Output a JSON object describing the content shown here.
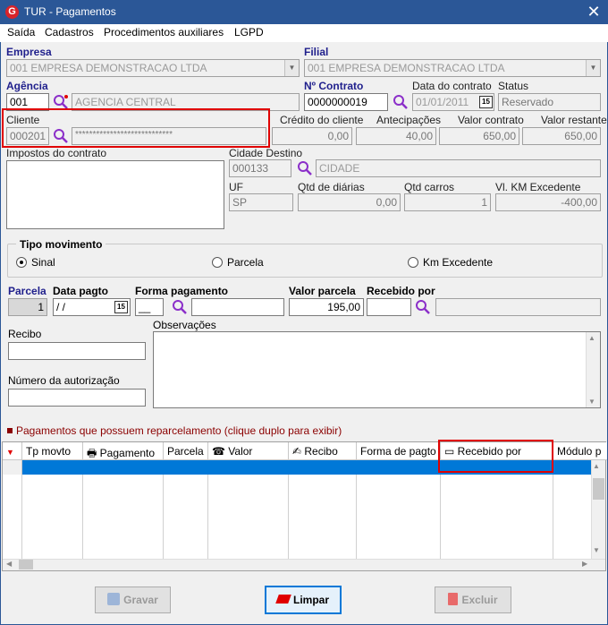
{
  "window": {
    "title": "TUR - Pagamentos",
    "close_glyph": "✕",
    "icon_letter": "G"
  },
  "menu": [
    "Saída",
    "Cadastros",
    "Procedimentos auxiliares",
    "LGPD"
  ],
  "fields": {
    "empresa": {
      "label": "Empresa",
      "value": "001 EMPRESA DEMONSTRACAO LTDA"
    },
    "filial": {
      "label": "Filial",
      "value": "001 EMPRESA DEMONSTRACAO LTDA"
    },
    "agencia": {
      "label": "Agência",
      "code": "001",
      "name": "AGENCIA CENTRAL"
    },
    "contrato": {
      "label": "Nº Contrato",
      "value": "0000000019"
    },
    "data_contrato": {
      "label": "Data do contrato",
      "value": "01/01/2011",
      "cal": "15"
    },
    "status": {
      "label": "Status",
      "value": "Reservado"
    },
    "cliente": {
      "label": "Cliente",
      "code": "000201",
      "name": "****************************"
    },
    "credito": {
      "label": "Crédito do cliente",
      "value": "0,00"
    },
    "antecipacoes": {
      "label": "Antecipações",
      "value": "40,00"
    },
    "valor_contrato": {
      "label": "Valor contrato",
      "value": "650,00"
    },
    "valor_restante": {
      "label": "Valor restante",
      "value": "650,00"
    },
    "impostos": {
      "label": "Impostos do contrato"
    },
    "cidade_destino": {
      "label": "Cidade Destino",
      "code": "000133",
      "name": "CIDADE"
    },
    "uf": {
      "label": "UF",
      "value": "SP"
    },
    "qtd_diarias": {
      "label": "Qtd de diárias",
      "value": "0,00"
    },
    "qtd_carros": {
      "label": "Qtd carros",
      "value": "1"
    },
    "vl_km": {
      "label": "Vl. KM Excedente",
      "value": "-400,00"
    }
  },
  "tipo_movimento": {
    "label": "Tipo movimento",
    "options": [
      "Sinal",
      "Parcela",
      "Km Excedente"
    ],
    "selected": "Sinal"
  },
  "pagamento": {
    "parcela_label": "Parcela",
    "parcela_value": "1",
    "data_label": "Data pagto",
    "data_value": " /  /",
    "cal": "15",
    "forma_label": "Forma pagamento",
    "forma_code": "__",
    "valor_label": "Valor parcela",
    "valor_value": "195,00",
    "recebido_label": "Recebido por"
  },
  "recibo": {
    "label": "Recibo"
  },
  "autorizacao": {
    "label": "Número da autorização"
  },
  "observacoes": {
    "label": "Observações"
  },
  "grid_note": "Pagamentos que possuem reparcelamento (clique duplo para exibir)",
  "grid": {
    "columns": [
      "Tp movto",
      "Pagamento",
      "Parcela",
      "Valor",
      "Recibo",
      "Forma de pagto",
      "Recebido por",
      "Módulo p"
    ]
  },
  "buttons": {
    "gravar": "Gravar",
    "limpar": "Limpar",
    "excluir": "Excluir"
  },
  "colors": {
    "titlebar": "#2b5797",
    "highlight": "#e00000",
    "selection": "#0078d7"
  }
}
